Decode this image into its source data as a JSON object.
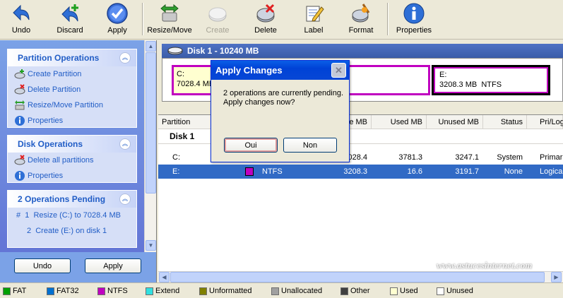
{
  "toolbar": {
    "undo": "Undo",
    "discard": "Discard",
    "apply": "Apply",
    "resize_move": "Resize/Move",
    "create": "Create",
    "delete": "Delete",
    "label": "Label",
    "format": "Format",
    "properties": "Properties"
  },
  "left_panel": {
    "partition_ops": {
      "title": "Partition Operations",
      "items": [
        "Create Partition",
        "Delete Partition",
        "Resize/Move Partition",
        "Properties"
      ]
    },
    "disk_ops": {
      "title": "Disk Operations",
      "items": [
        "Delete all partitions",
        "Properties"
      ]
    },
    "pending": {
      "title": "2 Operations Pending",
      "items": [
        "#  1  Resize (C:) to 7028.4 MB",
        "2  Create (E:) on disk 1"
      ]
    },
    "undo_button": "Undo",
    "apply_button": "Apply"
  },
  "disk": {
    "title": "Disk 1 - 10240 MB",
    "partitions": [
      {
        "letter": "C:",
        "info": "7028.4 MB"
      },
      {
        "letter": "E:",
        "info": "3208.3 MB  NTFS"
      }
    ]
  },
  "table": {
    "columns": [
      "Partition",
      "",
      "e MB",
      "Used MB",
      "Unused MB",
      "Status",
      "Pri/Log"
    ],
    "group": "Disk 1",
    "rows": [
      {
        "partition": "C:",
        "fs": "",
        "size": "7028.4",
        "used": "3781.3",
        "unused": "3247.1",
        "status": "System",
        "type": "Primar"
      },
      {
        "partition": "E:",
        "fs": "NTFS",
        "size": "3208.3",
        "used": "16.6",
        "unused": "3191.7",
        "status": "None",
        "type": "Logica"
      }
    ]
  },
  "dialog": {
    "title": "Apply Changes",
    "line1": "2 operations are currently pending.",
    "line2": "Apply changes now?",
    "yes": "Oui",
    "no": "Non"
  },
  "watermark": "www.astucesinternet.com",
  "legend": [
    "FAT",
    "FAT32",
    "NTFS",
    "Extend",
    "Unformatted",
    "Unallocated",
    "Other",
    "Used",
    "Unused"
  ],
  "colors": {
    "fat": "#00a000",
    "fat32": "#0070d0",
    "ntfs": "#c000c0",
    "extend": "#30e0e0",
    "unformatted": "#808000",
    "unallocated": "#a0a0a0",
    "other": "#404040",
    "used": "#ffffd0",
    "unused": "#ffffff"
  }
}
